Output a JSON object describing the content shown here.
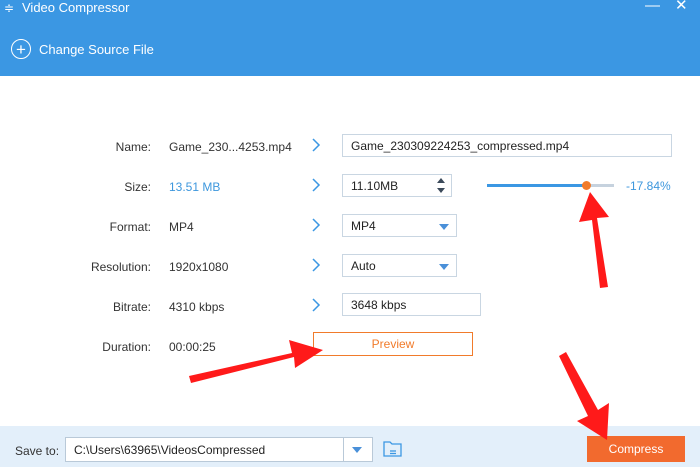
{
  "window": {
    "title": "Video Compressor",
    "minimize_glyph": "—",
    "close_glyph": "✕"
  },
  "toolbar": {
    "change_source_label": "Change Source File"
  },
  "form": {
    "name": {
      "label": "Name:",
      "original": "Game_230...4253.mp4",
      "output": "Game_230309224253_compressed.mp4"
    },
    "size": {
      "label": "Size:",
      "original": "13.51 MB",
      "output": "11.10MB",
      "slider_fraction": 0.78,
      "percent": "-17.84%"
    },
    "format": {
      "label": "Format:",
      "original": "MP4",
      "selected": "MP4"
    },
    "resolution": {
      "label": "Resolution:",
      "original": "1920x1080",
      "selected": "Auto"
    },
    "bitrate": {
      "label": "Bitrate:",
      "original": "4310 kbps",
      "output": "3648 kbps"
    },
    "duration": {
      "label": "Duration:",
      "original": "00:00:25"
    }
  },
  "preview_label": "Preview",
  "bottom": {
    "save_to_label": "Save to:",
    "path": "C:\\Users\\63965\\VideosCompressed",
    "compress_label": "Compress"
  },
  "colors": {
    "accent_blue": "#3b97e3",
    "accent_orange": "#f17b2b",
    "annotation_red": "#ff1a1a"
  }
}
